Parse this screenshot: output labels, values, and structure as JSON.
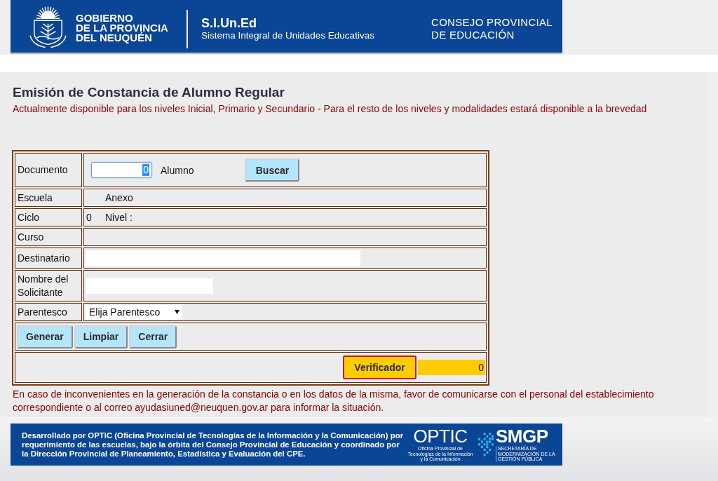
{
  "header": {
    "government": [
      "GOBIERNO",
      "DE LA PROVINCIA",
      "DEL NEUQUÉN"
    ],
    "system": {
      "acronym": "S.I.Un.Ed",
      "name": "Sistema Integral de Unidades Educativas"
    },
    "council": [
      "CONSEJO PROVINCIAL",
      "DE EDUCACIÓN"
    ]
  },
  "title": "Emisión de Constancia de Alumno Regular",
  "availability_notice": "Actualmente disponible para los niveles Inicial, Primario y Secundario - Para el resto de los niveles y modalidades estará disponible a la brevedad",
  "form": {
    "rows": [
      {
        "kind": "document",
        "label": "Documento",
        "field": {
          "value": "0",
          "focused": true
        },
        "student": "Alumno",
        "button": "Buscar"
      },
      {
        "kind": "info",
        "label": "Escuela",
        "detail": "Anexo"
      },
      {
        "kind": "info",
        "label": "Ciclo",
        "value": "0",
        "detail": "Nivel :"
      },
      {
        "kind": "info",
        "label": "Curso"
      },
      {
        "kind": "recipient",
        "label": "Destinatario"
      },
      {
        "kind": "requester",
        "label": "Nombre del Solicitante"
      },
      {
        "kind": "select",
        "label": "Parentesco",
        "value": "Elija Parentesco"
      },
      {
        "kind": "actions",
        "buttons": [
          "Generar",
          "Limpiar",
          "Cerrar"
        ]
      },
      {
        "kind": "verifier",
        "button": "Verificador",
        "field": {
          "value": "0"
        }
      }
    ]
  },
  "help_notice": "En caso de inconvenientes en la generación de la constancia o en los datos de la misma, favor de comunicarse con el personal del establecimiento correspondiente o al correo ayudasiuned@neuquen.gov.ar para informar la situación.",
  "footer": {
    "credits": "Desarrollado por OPTIC (Oficina Provincial de Tecnologías de la Información y la Comunicación) por requerimiento de las escuelas, bajo la órbita del Consejo Provincial de Educación y coordinado por la Dirección Provincial de Planeamiento, Estadística y Evaluación del CPE.",
    "logos": [
      {
        "kind": "optic",
        "wordmark": "OPTIC",
        "caption": "Oficina Provincial de Tecnologías de la Información y la Comunicación"
      },
      {
        "kind": "smgp",
        "wordmark": "SMGP",
        "caption": "SECRETARÍA DE MODERNIZACIÓN DE LA GESTIÓN PÚBLICA"
      }
    ]
  }
}
